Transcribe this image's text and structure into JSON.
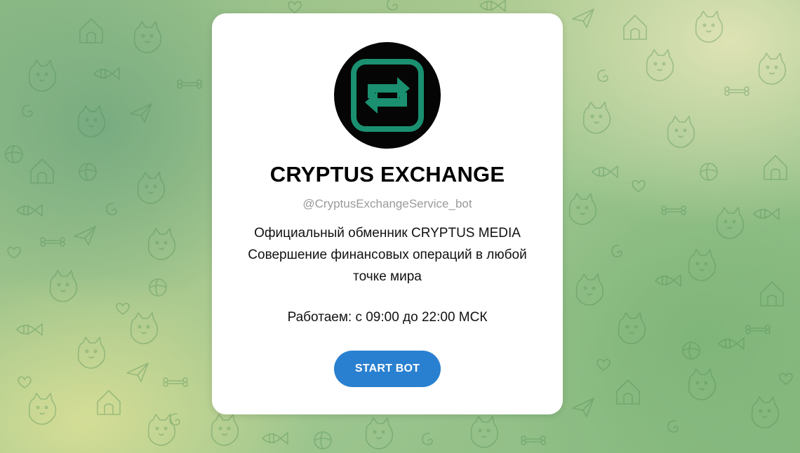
{
  "colors": {
    "accent_button": "#2a80d0",
    "logo_green": "#1a9070",
    "avatar_bg": "#050505",
    "card_bg": "#ffffff",
    "username_gray": "#9a9a9a"
  },
  "background": {
    "icon": "telegram-doodle-pattern"
  },
  "bot": {
    "avatar_icon": "exchange-arrows-icon",
    "title": "CRYPTUS EXCHANGE",
    "username": "@CryptusExchangeService_bot",
    "description_lines": [
      "Официальный обменник CRYPTUS MEDIA",
      "Совершение финансовых операций в любой",
      "точке мира"
    ],
    "hours": "Работаем: с 09:00 до 22:00 МСК",
    "start_label": "START BOT"
  }
}
